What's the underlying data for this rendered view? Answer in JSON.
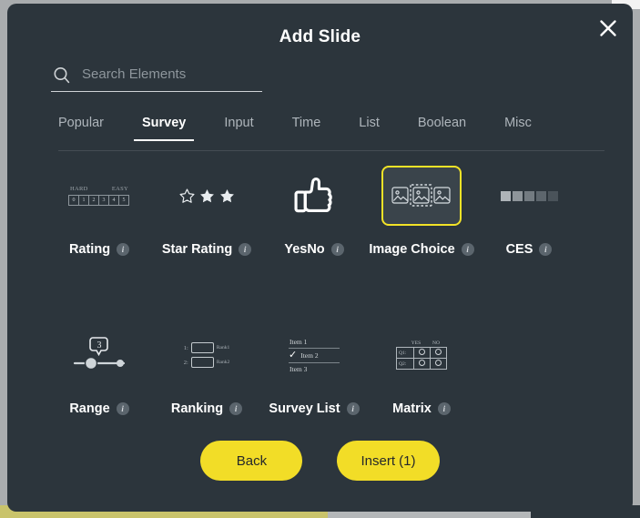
{
  "dialog": {
    "title": "Add Slide",
    "close_icon": "close-icon"
  },
  "search": {
    "placeholder": "Search Elements",
    "value": "",
    "icon": "search-icon"
  },
  "tabs": [
    {
      "label": "Popular",
      "active": false
    },
    {
      "label": "Survey",
      "active": true
    },
    {
      "label": "Input",
      "active": false
    },
    {
      "label": "Time",
      "active": false
    },
    {
      "label": "List",
      "active": false
    },
    {
      "label": "Boolean",
      "active": false
    },
    {
      "label": "Misc",
      "active": false
    }
  ],
  "elements": {
    "row1": [
      {
        "label": "Rating",
        "icon": "rating-scale-icon",
        "selected": false,
        "info": "i"
      },
      {
        "label": "Star Rating",
        "icon": "star-rating-icon",
        "selected": false,
        "info": "i"
      },
      {
        "label": "YesNo",
        "icon": "thumbs-up-icon",
        "selected": false,
        "info": "i"
      },
      {
        "label": "Image Choice",
        "icon": "image-choice-icon",
        "selected": true,
        "info": "i"
      },
      {
        "label": "CES",
        "icon": "ces-scale-icon",
        "selected": false,
        "info": "i"
      }
    ],
    "row2": [
      {
        "label": "Range",
        "icon": "range-slider-icon",
        "selected": false,
        "info": "i"
      },
      {
        "label": "Ranking",
        "icon": "ranking-icon",
        "selected": false,
        "info": "i"
      },
      {
        "label": "Survey List",
        "icon": "survey-list-icon",
        "selected": false,
        "info": "i"
      },
      {
        "label": "Matrix",
        "icon": "matrix-icon",
        "selected": false,
        "info": "i"
      }
    ]
  },
  "art": {
    "rating": {
      "left_label": "HARD",
      "right_label": "EASY",
      "boxes": [
        "0",
        "1",
        "2",
        "3",
        "4",
        "5"
      ]
    },
    "range": {
      "value": "3"
    },
    "ranking": {
      "rows": [
        {
          "num": "1:",
          "label": "Rank1"
        },
        {
          "num": "2:",
          "label": "Rank2"
        }
      ]
    },
    "survey_list": {
      "items": [
        "Item 1",
        "Item 2",
        "Item 3"
      ],
      "checked_index": 1,
      "check_glyph": "✓"
    },
    "matrix": {
      "columns": [
        "YES",
        "NO"
      ],
      "rows": [
        "Q1:",
        "Q2:"
      ]
    }
  },
  "footer": {
    "back_label": "Back",
    "insert_label": "Insert (1)"
  },
  "colors": {
    "accent_yellow": "#f2dd27",
    "selection_border": "#f2e327",
    "dialog_bg": "#2c353c",
    "text_primary": "#ffffff",
    "text_muted": "#aeb5bb"
  }
}
